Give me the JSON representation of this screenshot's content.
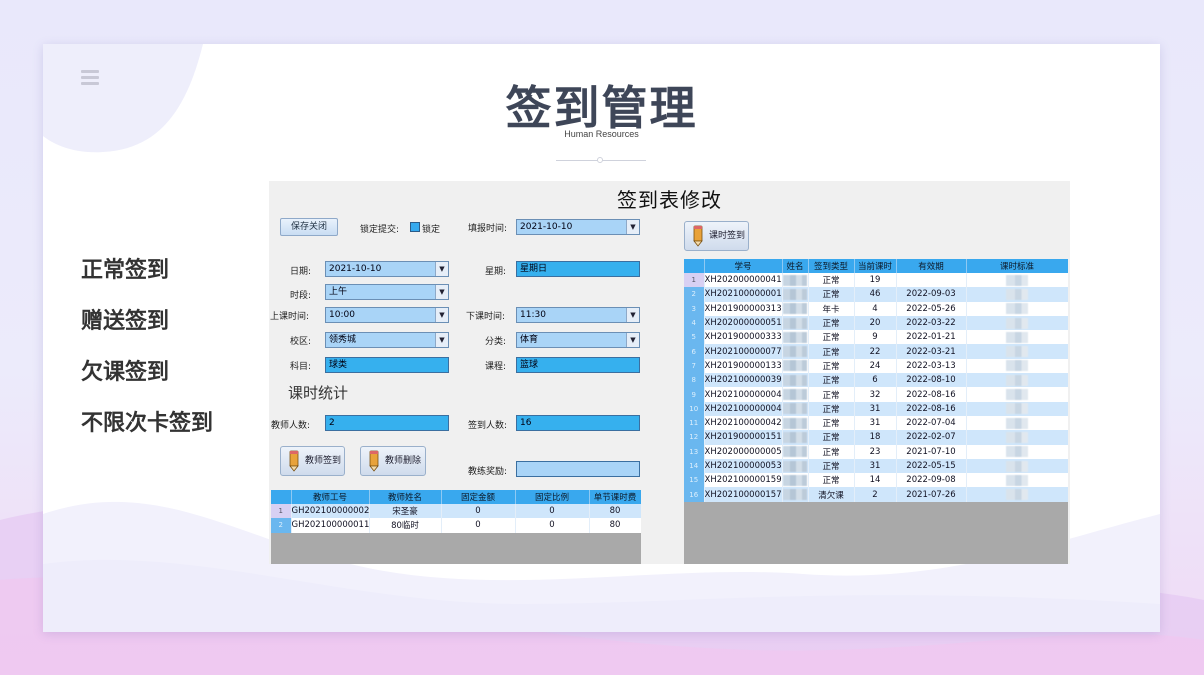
{
  "page": {
    "title": "签到管理",
    "subtitle": "Human Resources"
  },
  "left_menu": [
    "正常签到",
    "赠送签到",
    "欠课签到",
    "不限次卡签到"
  ],
  "app": {
    "title": "签到表修改",
    "save_close_label": "保存关闭",
    "lock_submit_label": "锁定提交:",
    "lock_label": "锁定",
    "fill_time_label": "填报时间:",
    "fill_time_value": "2021-10-10",
    "class_checkin_label": "课时签到",
    "date_label": "日期:",
    "date_value": "2021-10-10",
    "weekday_label": "星期:",
    "weekday_value": "星期日",
    "period_label": "时段:",
    "period_value": "上午",
    "start_time_label": "上课时间:",
    "start_time_value": "10:00",
    "end_time_label": "下课时间:",
    "end_time_value": "11:30",
    "campus_label": "校区:",
    "campus_value": "领秀城",
    "category_label": "分类:",
    "category_value": "体育",
    "subject_label": "科目:",
    "subject_value": "球类",
    "course_label": "课程:",
    "course_value": "篮球",
    "stats_title": "课时统计",
    "teacher_count_label": "教师人数:",
    "teacher_count_value": "2",
    "checkin_count_label": "签到人数:",
    "checkin_count_value": "16",
    "teacher_checkin_label": "教师签到",
    "teacher_delete_label": "教师删除",
    "coach_reward_label": "教练奖励:",
    "coach_reward_value": ""
  },
  "teacher_table": {
    "columns": [
      "教师工号",
      "教师姓名",
      "固定金额",
      "固定比例",
      "单节课时费"
    ],
    "rows": [
      {
        "no": "1",
        "id": "GH202100000002",
        "name": "宋圣豪",
        "amount": "0",
        "ratio": "0",
        "fee": "80"
      },
      {
        "no": "2",
        "id": "GH202100000011",
        "name": "80临时",
        "amount": "0",
        "ratio": "0",
        "fee": "80"
      }
    ]
  },
  "student_table": {
    "columns": [
      "学号",
      "姓名",
      "签到类型",
      "当前课时",
      "有效期",
      "课时标准"
    ],
    "rows": [
      {
        "no": "1",
        "id": "XH202000000041",
        "type": "正常",
        "hours": "19",
        "valid": ""
      },
      {
        "no": "2",
        "id": "XH202100000001",
        "type": "正常",
        "hours": "46",
        "valid": "2022-09-03"
      },
      {
        "no": "3",
        "id": "XH201900000313",
        "type": "年卡",
        "hours": "4",
        "valid": "2022-05-26"
      },
      {
        "no": "4",
        "id": "XH202000000051",
        "type": "正常",
        "hours": "20",
        "valid": "2022-03-22"
      },
      {
        "no": "5",
        "id": "XH201900000333",
        "type": "正常",
        "hours": "9",
        "valid": "2022-01-21"
      },
      {
        "no": "6",
        "id": "XH202100000077",
        "type": "正常",
        "hours": "22",
        "valid": "2022-03-21"
      },
      {
        "no": "7",
        "id": "XH201900000133",
        "type": "正常",
        "hours": "24",
        "valid": "2022-03-13"
      },
      {
        "no": "8",
        "id": "XH202100000039",
        "type": "正常",
        "hours": "6",
        "valid": "2022-08-10"
      },
      {
        "no": "9",
        "id": "XH202100000004",
        "type": "正常",
        "hours": "32",
        "valid": "2022-08-16"
      },
      {
        "no": "10",
        "id": "XH202100000004",
        "type": "正常",
        "hours": "31",
        "valid": "2022-08-16"
      },
      {
        "no": "11",
        "id": "XH202100000042",
        "type": "正常",
        "hours": "31",
        "valid": "2022-07-04"
      },
      {
        "no": "12",
        "id": "XH201900000151",
        "type": "正常",
        "hours": "18",
        "valid": "2022-02-07"
      },
      {
        "no": "13",
        "id": "XH202000000005",
        "type": "正常",
        "hours": "23",
        "valid": "2021-07-10"
      },
      {
        "no": "14",
        "id": "XH202100000053",
        "type": "正常",
        "hours": "31",
        "valid": "2022-05-15"
      },
      {
        "no": "15",
        "id": "XH202100000159",
        "type": "正常",
        "hours": "14",
        "valid": "2022-09-08"
      },
      {
        "no": "16",
        "id": "XH202100000157",
        "type": "清欠课",
        "hours": "2",
        "valid": "2021-07-26"
      }
    ]
  },
  "colors": {
    "title": "#3e4658",
    "field_blue": "#36b0ee",
    "combo_blue": "#a9d4f7",
    "grid_header": "#39a8ee",
    "grid_alt_row": "#cfe6fb"
  }
}
